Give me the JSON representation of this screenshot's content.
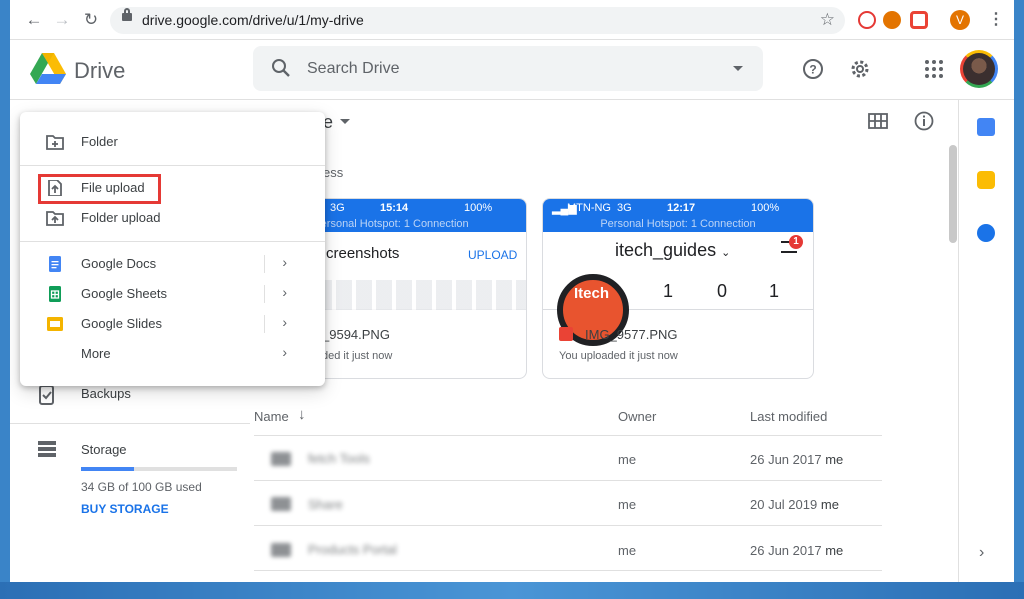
{
  "browser": {
    "url": "drive.google.com/drive/u/1/my-drive",
    "profile_initial": "V"
  },
  "header": {
    "brand": "Drive",
    "search_placeholder": "Search Drive"
  },
  "new_menu": {
    "items": [
      {
        "label": "Folder",
        "icon": "folder-plus-icon"
      },
      {
        "label": "File upload",
        "icon": "file-upload-icon"
      },
      {
        "label": "Folder upload",
        "icon": "folder-upload-icon"
      },
      {
        "label": "Google Docs",
        "icon": "docs-icon"
      },
      {
        "label": "Google Sheets",
        "icon": "sheets-icon"
      },
      {
        "label": "Google Slides",
        "icon": "slides-icon"
      },
      {
        "label": "More",
        "icon": ""
      }
    ],
    "highlight_color": "#e53935"
  },
  "sidebar": {
    "backups": "Backups",
    "storage": "Storage",
    "storage_used": "34 GB of 100 GB used",
    "storage_fraction": 0.34,
    "buy_storage": "BUY STORAGE"
  },
  "main": {
    "title_fragment": "e",
    "quick_access_fragment": "ess",
    "cards": [
      {
        "status_signal": "3G",
        "status_time": "15:14",
        "status_battery": "100%",
        "hotspot": "Personal Hotspot: 1 Connection",
        "preview_title": "creenshots",
        "preview_action": "UPLOAD",
        "file_name": "_9594.PNG",
        "meta": "ded it just now"
      },
      {
        "status_carrier": "MTN-NG",
        "status_signal": "3G",
        "status_time": "12:17",
        "status_battery": "100%",
        "hotspot": "Personal Hotspot: 1 Connection",
        "preview_title": "itech_guides",
        "badge": "1",
        "logo_text": "Itech",
        "stats": [
          "1",
          "0",
          "1"
        ],
        "file_name": "IMG_9577.PNG",
        "meta": "You uploaded it just now"
      }
    ],
    "table": {
      "headers": {
        "name": "Name",
        "owner": "Owner",
        "modified": "Last modified"
      },
      "rows": [
        {
          "name": "fetch Tools",
          "owner": "me",
          "date": "26 Jun 2017",
          "by": "me"
        },
        {
          "name": "Share",
          "owner": "me",
          "date": "20 Jul 2019",
          "by": "me"
        },
        {
          "name": "Products Portal",
          "owner": "me",
          "date": "26 Jun 2017",
          "by": "me"
        }
      ]
    }
  }
}
